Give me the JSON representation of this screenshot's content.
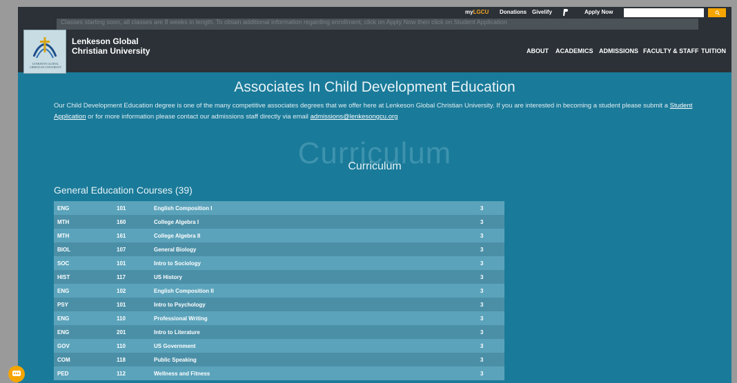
{
  "topbar": {
    "my_prefix": "my",
    "my_suffix": "LGCU",
    "donations": "Donations",
    "givelify": "Givelify",
    "apply_now": "Apply Now",
    "search_placeholder": "",
    "search_button_icon": "search-icon"
  },
  "ticker": {
    "text": "Classes starting soon, all classes are 8 weeks in length. To obtain additional information regarding enrollment, click on Apply Now then click on Student Application"
  },
  "brand": {
    "line1": "Lenkeson Global",
    "line2": "Christian University",
    "logo_caption_1": "LENKESON GLOBAL",
    "logo_caption_2": "CHRISTIAN UNIVERSITY"
  },
  "nav": [
    "ABOUT",
    "ACADEMICS",
    "ADMISSIONS",
    "FACULTY & STAFF",
    "TUITION"
  ],
  "page": {
    "title": "Associates In Child Development Education",
    "intro_1": "Our Child Development Education degree is one of the many competitive associates degrees that we offer here at Lenkeson Global Christian University. If you are interested in becoming a student please submit a ",
    "intro_link_1": "Student Application",
    "intro_2": " or for more information please contact our admissions staff directly via email ",
    "intro_link_2": "admissions@lenkesongcu.org",
    "curriculum_ghost": "Curriculum",
    "curriculum_title": "Curriculum",
    "section_heading": "General Education Courses (39)"
  },
  "courses": [
    {
      "dept": "ENG",
      "num": "101",
      "title": "English Composition I",
      "credits": "3"
    },
    {
      "dept": "MTH",
      "num": "160",
      "title": "College Algebra I",
      "credits": "3"
    },
    {
      "dept": "MTH",
      "num": "161",
      "title": "College Algebra II",
      "credits": "3"
    },
    {
      "dept": "BIOL",
      "num": "107",
      "title": "General Biology",
      "credits": "3"
    },
    {
      "dept": "SOC",
      "num": "101",
      "title": "Intro to Sociology",
      "credits": "3"
    },
    {
      "dept": "HIST",
      "num": "117",
      "title": "US History",
      "credits": "3"
    },
    {
      "dept": "ENG",
      "num": "102",
      "title": "English Composition II",
      "credits": "3"
    },
    {
      "dept": "PSY",
      "num": "101",
      "title": "Intro to Psychology",
      "credits": "3"
    },
    {
      "dept": "ENG",
      "num": "110",
      "title": "Professional Writing",
      "credits": "3"
    },
    {
      "dept": "ENG",
      "num": "201",
      "title": "Intro to Literature",
      "credits": "3"
    },
    {
      "dept": "GOV",
      "num": "110",
      "title": "US Government",
      "credits": "3"
    },
    {
      "dept": "COM",
      "num": "118",
      "title": "Public Speaking",
      "credits": "3"
    },
    {
      "dept": "PED",
      "num": "112",
      "title": "Wellness and Fitness",
      "credits": "3"
    }
  ],
  "colors": {
    "page_bg": "#1a7a99",
    "header_bg": "#2b3137",
    "accent": "#f6a500",
    "row_light": "#5ba3bb",
    "row_dark": "#4b8fa7"
  }
}
